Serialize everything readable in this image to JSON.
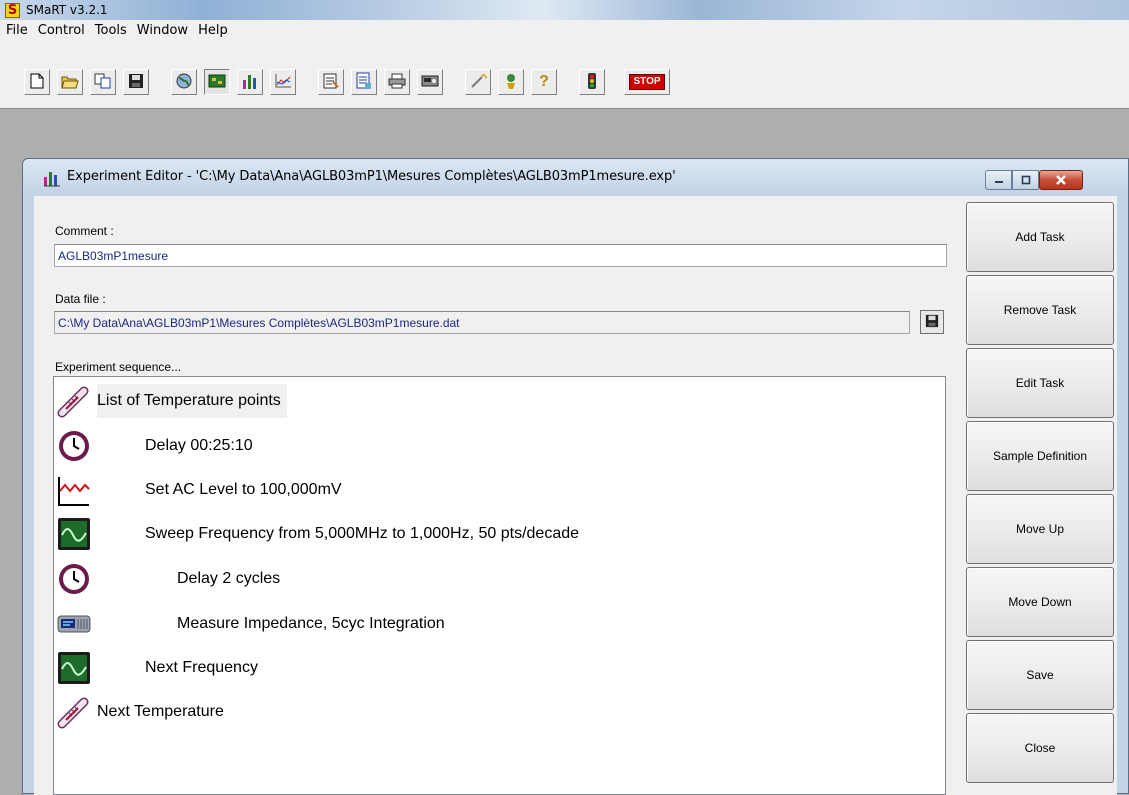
{
  "app": {
    "logo_letter": "S",
    "title": "SMaRT v3.2.1"
  },
  "menu": {
    "items": [
      "File",
      "Control",
      "Tools",
      "Window",
      "Help"
    ]
  },
  "toolbar": {
    "icons": [
      "new-file-icon",
      "open-folder-icon",
      "copy-icon",
      "save-icon",
      "globe-icon",
      "board-icon",
      "chart-bars-icon",
      "graph-icon",
      "properties-icon",
      "report-icon",
      "print-icon",
      "device-icon",
      "wand-icon",
      "person-icon",
      "help-icon",
      "traffic-light-icon"
    ],
    "stop_label": "STOP",
    "accent": "#d00000"
  },
  "editor": {
    "title": "Experiment Editor - 'C:\\My Data\\Ana\\AGLB03mP1\\Mesures Complètes\\AGLB03mP1mesure.exp'",
    "comment_label": "Comment :",
    "comment_value": "AGLB03mP1mesure",
    "datafile_label": "Data file :",
    "datafile_value": "C:\\My Data\\Ana\\AGLB03mP1\\Mesures Complètes\\AGLB03mP1mesure.dat",
    "sequence_label": "Experiment sequence...",
    "sequence": [
      {
        "icon": "thermometer-icon",
        "text": "List of Temperature points"
      },
      {
        "icon": "clock-icon",
        "text": "Delay 00:25:10"
      },
      {
        "icon": "ac-wave-icon",
        "text": "Set AC Level to 100,000mV"
      },
      {
        "icon": "oscilloscope-icon",
        "text": "Sweep Frequency from 5,000MHz to 1,000Hz, 50 pts/decade"
      },
      {
        "icon": "clock-icon",
        "text": "Delay 2 cycles"
      },
      {
        "icon": "impedance-meter-icon",
        "text": "Measure Impedance, 5cyc Integration"
      },
      {
        "icon": "oscilloscope-icon",
        "text": "Next Frequency"
      },
      {
        "icon": "thermometer-icon",
        "text": "Next Temperature"
      }
    ],
    "buttons": [
      "Add Task",
      "Remove Task",
      "Edit Task",
      "Sample Definition",
      "Move Up",
      "Move Down",
      "Save",
      "Close"
    ]
  }
}
